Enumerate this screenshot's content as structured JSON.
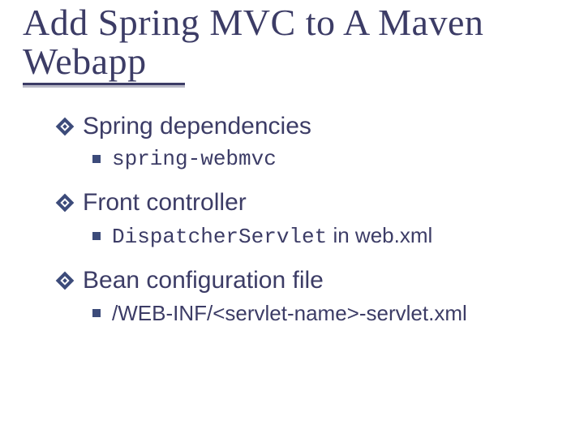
{
  "title_line1": "Add Spring MVC to A Maven",
  "title_line2": "Webapp",
  "items": {
    "a": {
      "heading": "Spring dependencies",
      "sub_code": "spring-webmvc"
    },
    "b": {
      "heading": "Front controller",
      "sub_code": "DispatcherServlet",
      "sub_tail": " in web.xml"
    },
    "c": {
      "heading": "Bean configuration file",
      "sub_text": "/WEB-INF/<servlet-name>-servlet.xml"
    }
  }
}
